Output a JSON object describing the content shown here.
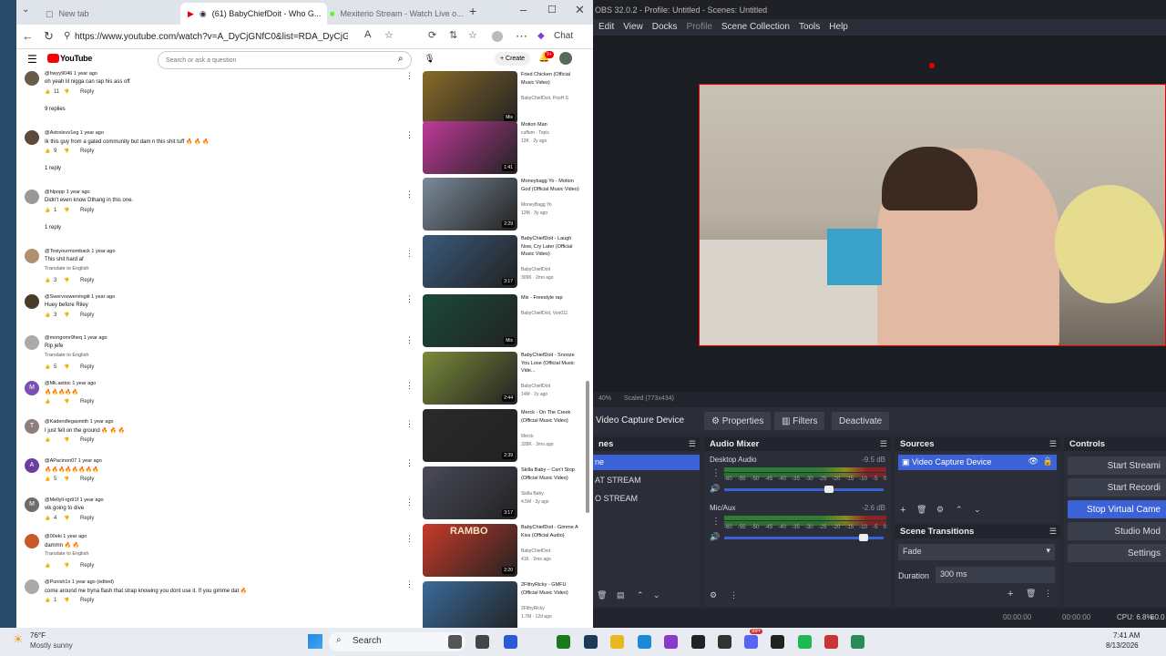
{
  "browser": {
    "tabs": [
      {
        "label": "New tab"
      },
      {
        "label": "(61) BabyChiefDoit - Who G..."
      },
      {
        "label": "Mexiterio Stream - Watch Live o..."
      }
    ],
    "url": "https://www.youtube.com/watch?v=A_DyCjGNfC0&list=RDA_DyCjG...",
    "chat_label": "Chat"
  },
  "youtube": {
    "logo": "YouTube",
    "search_placeholder": "Search or ask a question",
    "create_label": "+ Create",
    "notif_count": "9+",
    "comments": [
      {
        "author": "@hwyy9046 1 year ago",
        "text": "oh yeah lil nigga can rap his ass off",
        "likes": "11",
        "reply": "Reply",
        "replies": "9 replies",
        "color": "#6a5a4a"
      },
      {
        "author": "@Astrolevv1eg 1 year ago",
        "text": "Ik this guy from a gated community but dam n this shit tuff 🔥 🔥 🔥",
        "likes": "9",
        "reply": "Reply",
        "replies": "1 reply",
        "color": "#5a4a3a"
      },
      {
        "author": "@hlpopp 1 year ago",
        "text": "Didn't even know Dthang in this one.",
        "likes": "1",
        "reply": "Reply",
        "replies": "1 reply",
        "color": "#999999"
      },
      {
        "author": "@Toxiyourmomback 1 year ago",
        "text": "This shit hard af",
        "translate": "Translate to English",
        "likes": "3",
        "reply": "Reply",
        "color": "#b09070"
      },
      {
        "author": "@Swervoswervingiit 1 year ago",
        "text": "Huey before Riley",
        "likes": "3",
        "reply": "Reply",
        "color": "#4a3a2a"
      },
      {
        "author": "@mongomr9heq 1 year ago",
        "text": "Rip jefe",
        "translate": "Translate to English",
        "likes": "5",
        "reply": "Reply",
        "color": "#aaaaaa"
      },
      {
        "author": "@Mk.astioc 1 year ago",
        "text": "🔥🔥🔥🔥🔥",
        "likes": "",
        "reply": "Reply",
        "letter": "M",
        "color": "#7b4fb3"
      },
      {
        "author": "@Kadendlegasmith 1 year ago",
        "text": "I just fell on the ground 🔥 🔥 🔥",
        "likes": "",
        "reply": "Reply",
        "letter": "T",
        "color": "#8d7d7d"
      },
      {
        "author": "@APacinon07 1 year ago",
        "text": "🔥🔥🔥🔥🔥🔥🔥🔥",
        "likes": "5",
        "reply": "Reply",
        "letter": "A",
        "color": "#6a3fa0"
      },
      {
        "author": "@Mellyll-rgr91f 1 year ago",
        "text": "vik going to dive",
        "likes": "4",
        "reply": "Reply",
        "letter": "M",
        "color": "#6d6d6d"
      },
      {
        "author": "@00eki 1 year ago",
        "text": "dammn 🔥 🔥",
        "translate": "Translate to English",
        "likes": "",
        "reply": "Reply",
        "color": "#c85a2a"
      },
      {
        "author": "@Punish1x 1 year ago (edited)",
        "text": "come around me tryna flash that strap knowing you dont use it. If you gimme dat 🔥",
        "likes": "1",
        "reply": "Reply",
        "color": "#aaaaaa"
      }
    ],
    "videos": [
      {
        "title": "Fried Chicken (Official Music Video)",
        "channel": "BabyChiefDoit, PooH S",
        "meta": "",
        "duration": "Mix",
        "color": "#8a6a2a"
      },
      {
        "title": "Motion Man",
        "channel": "cuffem - Topic",
        "meta": "12K · 2y ago",
        "duration": "1:41",
        "color": "#c03a9a"
      },
      {
        "title": "Moneybagg Yo - Motion God (Official Music Video)",
        "channel": "MoneyBagg Yo",
        "meta": "12M · 3y ago",
        "duration": "2:29",
        "color": "#7a8a9a"
      },
      {
        "title": "BabyChiefDoit - Laugh Now, Cry Later (Official Music Video)",
        "channel": "BabyChiefDoit",
        "meta": "309K · 2mo ago",
        "duration": "3:17",
        "color": "#3a5a7a"
      },
      {
        "title": "Mix - Freestyle rap",
        "channel": "BabyChiefDoit, Von011",
        "meta": "",
        "duration": "Mix",
        "color": "#1a4a3a"
      },
      {
        "title": "BabyChiefDoit - Snooze You Lose (Official Music Vide...",
        "channel": "BabyChiefDoit",
        "meta": "14M · 2y ago",
        "duration": "2:44",
        "color": "#7a8a3a"
      },
      {
        "title": "Merck - On The Creek (Official Music Video)",
        "channel": "Merck",
        "meta": "328K · 2mo ago",
        "duration": "2:39",
        "color": "#2a2a2a"
      },
      {
        "title": "Skilla Baby – Can't Stop (Official Music Video)",
        "channel": "Skilla Baby",
        "meta": "4.5M · 3y ago",
        "duration": "3:17",
        "color": "#4a4a5a"
      },
      {
        "title": "BabyChiefDoit - Gimme A Kiss (Official Audio)",
        "channel": "BabyChiefDoit",
        "meta": "41K · 2mo ago",
        "duration": "2:20",
        "color": "#c83a2a",
        "overlay": "RAMBO"
      },
      {
        "title": "2FlthyRicky - GMFU (Official Music Video)",
        "channel": "2FlthyRicky",
        "meta": "1.7M · 12d ago",
        "duration": "",
        "color": "#3a6a9a"
      }
    ]
  },
  "obs": {
    "title": "OBS 32.0.2 - Profile: Untitled - Scenes: Untitled",
    "menu": [
      "Edit",
      "View",
      "Docks",
      "Profile",
      "Scene Collection",
      "Tools",
      "Help"
    ],
    "zoom": "40%",
    "scaled": "Scaled (773x434)",
    "source_name": "Video Capture Device",
    "properties": "Properties",
    "filters": "Filters",
    "deactivate": "Deactivate",
    "scenes_header": "nes",
    "scenes": [
      "ne",
      "AT STREAM",
      "O STREAM"
    ],
    "mixer_header": "Audio Mixer",
    "channels": [
      {
        "name": "Desktop Audio",
        "db": "-9.5 dB"
      },
      {
        "name": "Mic/Aux",
        "db": "-2.6 dB"
      }
    ],
    "ticks": [
      "-60",
      "-55",
      "-50",
      "-45",
      "-40",
      "-35",
      "-30",
      "-25",
      "-20",
      "-15",
      "-10",
      "-5",
      "0"
    ],
    "sources_header": "Sources",
    "transitions_header": "Scene Transitions",
    "transition": "Fade",
    "duration_label": "Duration",
    "duration_value": "300 ms",
    "controls_header": "Controls",
    "controls": [
      "Start Streami",
      "Start Recordi",
      "Stop Virtual Came",
      "Studio Mod",
      "Settings"
    ],
    "status_time1": "00:00:00",
    "status_time2": "00:00:00",
    "cpu": "CPU: 6.8%",
    "fps": "60.0"
  },
  "taskbar": {
    "weather_temp": "76°F",
    "weather_desc": "Mostly sunny",
    "search": "Search",
    "time": "7:41 AM",
    "date": "8/13/2026",
    "badge": "99+"
  }
}
